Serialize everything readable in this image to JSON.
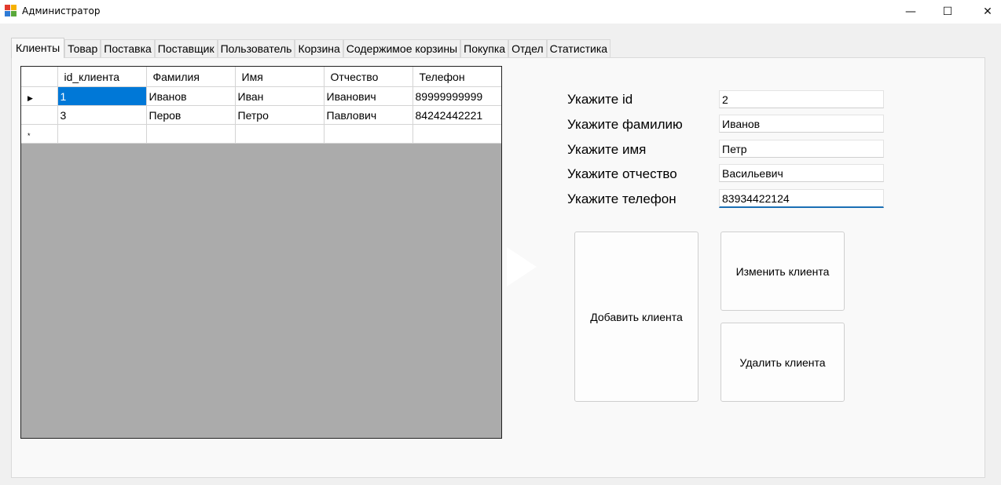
{
  "window": {
    "title": "Администратор",
    "controls": {
      "minimize": "—",
      "maximize": "☐",
      "close": "✕"
    }
  },
  "tabs": [
    {
      "label": "Клиенты",
      "active": true
    },
    {
      "label": "Товар"
    },
    {
      "label": "Поставка"
    },
    {
      "label": "Поставщик"
    },
    {
      "label": "Пользователь"
    },
    {
      "label": "Корзина"
    },
    {
      "label": "Содержимое корзины"
    },
    {
      "label": "Покупка"
    },
    {
      "label": "Отдел"
    },
    {
      "label": "Статистика"
    }
  ],
  "grid": {
    "columns": [
      "id_клиента",
      "Фамилия",
      "Имя",
      "Отчество",
      "Телефон"
    ],
    "rows": [
      {
        "marker": "▶",
        "cells": [
          "1",
          "Иванов",
          "Иван",
          "Иванович",
          "89999999999"
        ]
      },
      {
        "marker": "",
        "cells": [
          "3",
          "Перов",
          "Петро",
          "Павлович",
          "84242442221"
        ]
      },
      {
        "marker": "*",
        "cells": [
          "",
          "",
          "",
          "",
          ""
        ]
      }
    ]
  },
  "form": {
    "id": {
      "label": "Укажите id",
      "value": "2"
    },
    "surname": {
      "label": "Укажите фамилию",
      "value": "Иванов"
    },
    "name": {
      "label": "Укажите имя",
      "value": "Петр"
    },
    "patronymic": {
      "label": "Укажите отчество",
      "value": "Васильевич"
    },
    "phone": {
      "label": "Укажите телефон",
      "value": "83934422124"
    }
  },
  "buttons": {
    "add": "Добавить клиента",
    "edit": "Изменить клиента",
    "delete": "Удалить клиента"
  }
}
